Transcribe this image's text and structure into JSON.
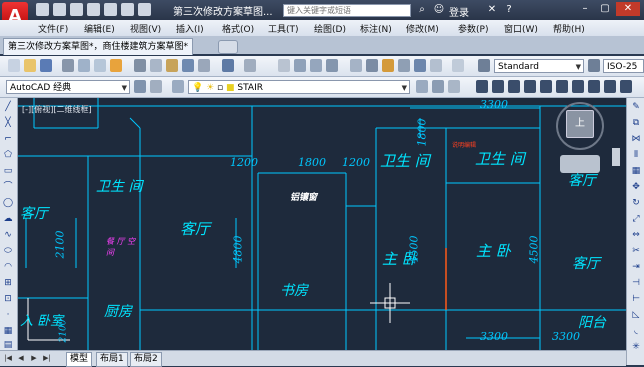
{
  "app": {
    "logo_letter": "A",
    "window_title": "第三次修改方案草图...",
    "search_placeholder": "键入关键字或短语",
    "login_label": "登录"
  },
  "menu": [
    "文件(F)",
    "编辑(E)",
    "视图(V)",
    "插入(I)",
    "格式(O)",
    "工具(T)",
    "绘图(D)",
    "标注(N)",
    "修改(M)",
    "参数(P)",
    "窗口(W)",
    "帮助(H)"
  ],
  "doc_tab": "第三次修改方案草图*，商住楼建筑方案草图*",
  "toolbar1": {
    "text_style": "Standard",
    "dim_style": "ISO-25"
  },
  "toolbar2": {
    "workspace": "AutoCAD 经典",
    "layer": "STAIR"
  },
  "viewport": {
    "label": "[-][俯视][二维线框]",
    "viewcube_face": "上"
  },
  "drawing": {
    "rooms": [
      {
        "text": "卫生  间"
      },
      {
        "text": "客厅"
      },
      {
        "text": "客厅"
      },
      {
        "text": "卫生  间"
      },
      {
        "text": "卫生  间"
      },
      {
        "text": "客厅"
      },
      {
        "text": "主  卧"
      },
      {
        "text": "主  卧"
      },
      {
        "text": "客厅"
      },
      {
        "text": "书房"
      },
      {
        "text": "厨房"
      },
      {
        "text": "入  卧室"
      },
      {
        "text": "阳台"
      }
    ],
    "dimensions": [
      "3300",
      "2100",
      "1200",
      "1800",
      "1200",
      "4800",
      "4500",
      "4500",
      "1800",
      "3300",
      "3300",
      "2100"
    ],
    "note_white": "铝镶窗",
    "note_magenta": "餐 厅 空 间",
    "note_red": "说明编辑"
  },
  "layout_tabs": [
    "模型",
    "布局1",
    "布局2"
  ]
}
